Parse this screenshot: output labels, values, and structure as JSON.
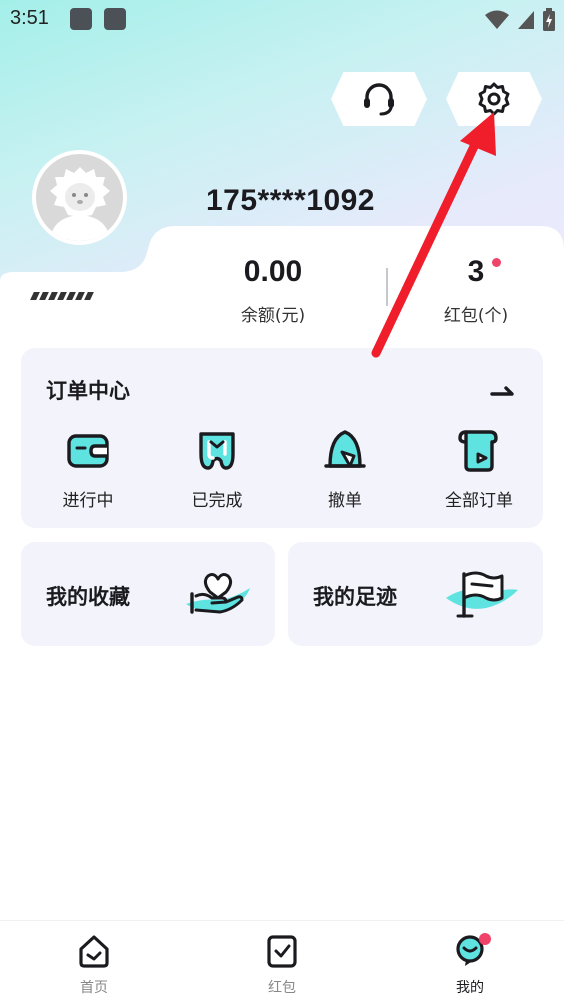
{
  "status_bar": {
    "time": "3:51"
  },
  "header": {
    "service_icon": "headset-icon",
    "settings_icon": "gear-icon",
    "phone": "175****1092"
  },
  "stats": {
    "balance_value": "0.00",
    "balance_label": "余额(元)",
    "redpacket_value": "3",
    "redpacket_label": "红包(个)"
  },
  "order_center": {
    "title": "订单中心",
    "items": [
      {
        "label": "进行中",
        "icon": "wallet-icon"
      },
      {
        "label": "已完成",
        "icon": "tooth-check-icon"
      },
      {
        "label": "撤单",
        "icon": "bell-return-icon"
      },
      {
        "label": "全部订单",
        "icon": "scroll-icon"
      }
    ]
  },
  "shortcuts": {
    "favorites_label": "我的收藏",
    "favorites_icon": "hand-heart-icon",
    "footprints_label": "我的足迹",
    "footprints_icon": "flag-icon"
  },
  "bottom_nav": {
    "items": [
      {
        "label": "首页",
        "icon": "home-icon"
      },
      {
        "label": "红包",
        "icon": "redpacket-icon"
      },
      {
        "label": "我的",
        "icon": "profile-icon"
      }
    ],
    "active": "我的"
  },
  "colors": {
    "accent_cyan": "#5ee3e0",
    "badge_red": "#f0436a",
    "annotation_red": "#f01d2a"
  }
}
